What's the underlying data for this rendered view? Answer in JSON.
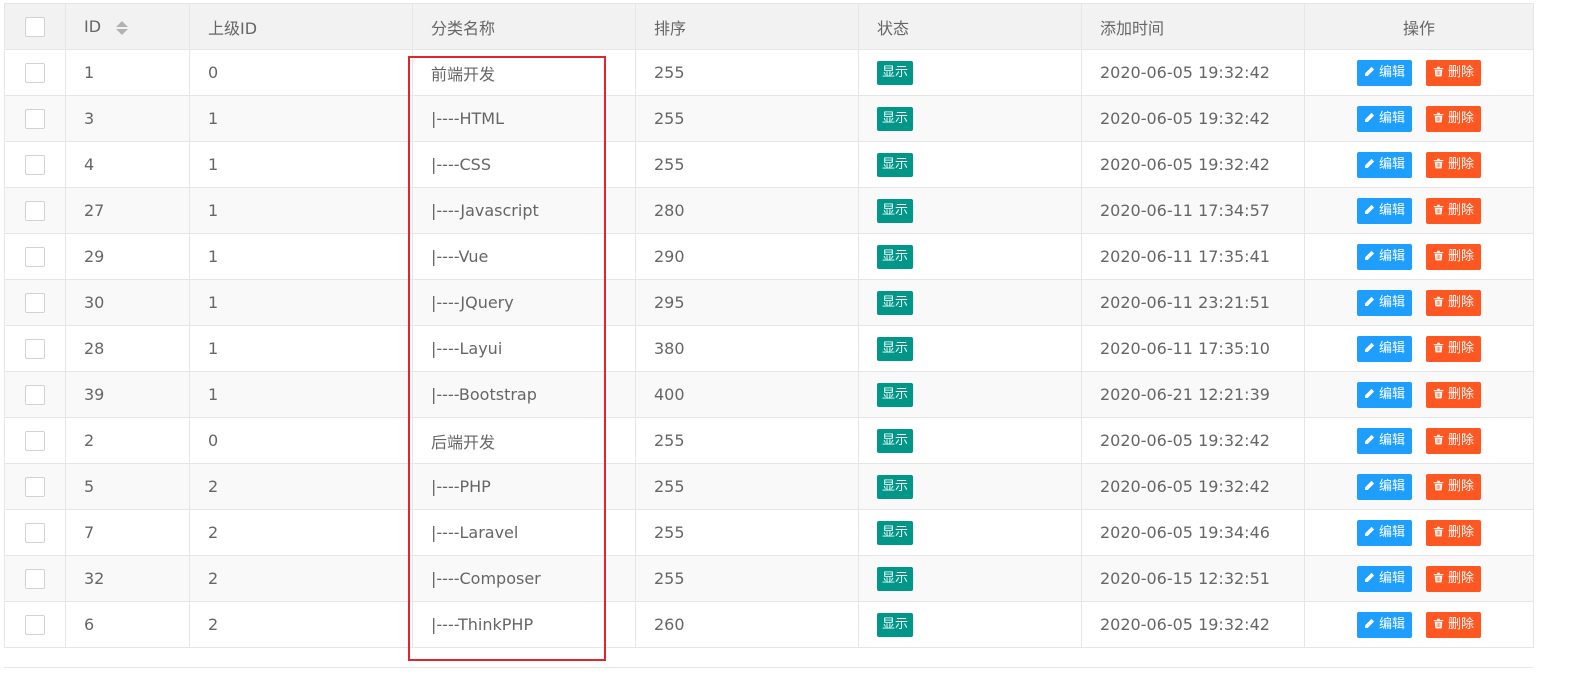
{
  "table": {
    "headers": {
      "id": "ID",
      "parent_id": "上级ID",
      "name": "分类名称",
      "sort": "排序",
      "status": "状态",
      "created": "添加时间",
      "actions": "操作"
    },
    "edit_label": "编辑",
    "delete_label": "删除",
    "rows": [
      {
        "id": "1",
        "parent_id": "0",
        "name": "前端开发",
        "sort": "255",
        "status": "显示",
        "created": "2020-06-05 19:32:42"
      },
      {
        "id": "3",
        "parent_id": "1",
        "name": "|----HTML",
        "sort": "255",
        "status": "显示",
        "created": "2020-06-05 19:32:42"
      },
      {
        "id": "4",
        "parent_id": "1",
        "name": "|----CSS",
        "sort": "255",
        "status": "显示",
        "created": "2020-06-05 19:32:42"
      },
      {
        "id": "27",
        "parent_id": "1",
        "name": "|----Javascript",
        "sort": "280",
        "status": "显示",
        "created": "2020-06-11 17:34:57"
      },
      {
        "id": "29",
        "parent_id": "1",
        "name": "|----Vue",
        "sort": "290",
        "status": "显示",
        "created": "2020-06-11 17:35:41"
      },
      {
        "id": "30",
        "parent_id": "1",
        "name": "|----JQuery",
        "sort": "295",
        "status": "显示",
        "created": "2020-06-11 23:21:51"
      },
      {
        "id": "28",
        "parent_id": "1",
        "name": "|----Layui",
        "sort": "380",
        "status": "显示",
        "created": "2020-06-11 17:35:10"
      },
      {
        "id": "39",
        "parent_id": "1",
        "name": "|----Bootstrap",
        "sort": "400",
        "status": "显示",
        "created": "2020-06-21 12:21:39"
      },
      {
        "id": "2",
        "parent_id": "0",
        "name": "后端开发",
        "sort": "255",
        "status": "显示",
        "created": "2020-06-05 19:32:42"
      },
      {
        "id": "5",
        "parent_id": "2",
        "name": "|----PHP",
        "sort": "255",
        "status": "显示",
        "created": "2020-06-05 19:32:42"
      },
      {
        "id": "7",
        "parent_id": "2",
        "name": "|----Laravel",
        "sort": "255",
        "status": "显示",
        "created": "2020-06-05 19:34:46"
      },
      {
        "id": "32",
        "parent_id": "2",
        "name": "|----Composer",
        "sort": "255",
        "status": "显示",
        "created": "2020-06-15 12:32:51"
      },
      {
        "id": "6",
        "parent_id": "2",
        "name": "|----ThinkPHP",
        "sort": "260",
        "status": "显示",
        "created": "2020-06-05 19:32:42"
      }
    ]
  },
  "colors": {
    "status_badge": "#009688",
    "edit_button": "#1e9fff",
    "delete_button": "#ff5722",
    "highlight_box": "#e0262c"
  },
  "icons": {
    "edit": "pencil-icon",
    "delete": "trash-icon",
    "sort": "sort-icon"
  }
}
